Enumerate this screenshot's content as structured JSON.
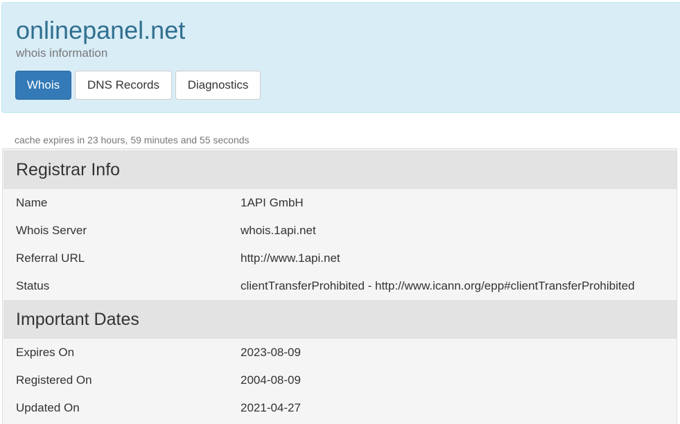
{
  "header": {
    "title": "onlinepanel.net",
    "subtitle": "whois information",
    "tabs": [
      {
        "label": "Whois",
        "active": true
      },
      {
        "label": "DNS Records",
        "active": false
      },
      {
        "label": "Diagnostics",
        "active": false
      }
    ]
  },
  "cache_note": "cache expires in 23 hours, 59 minutes and 55 seconds",
  "sections": [
    {
      "heading": "Registrar Info",
      "rows": [
        {
          "label": "Name",
          "value": "1API GmbH"
        },
        {
          "label": "Whois Server",
          "value": "whois.1api.net"
        },
        {
          "label": "Referral URL",
          "value": "http://www.1api.net"
        },
        {
          "label": "Status",
          "value": "clientTransferProhibited - http://www.icann.org/epp#clientTransferProhibited"
        }
      ]
    },
    {
      "heading": "Important Dates",
      "rows": [
        {
          "label": "Expires On",
          "value": "2023-08-09"
        },
        {
          "label": "Registered On",
          "value": "2004-08-09"
        },
        {
          "label": "Updated On",
          "value": "2021-04-27"
        }
      ]
    }
  ],
  "colors": {
    "header_bg": "#d9edf7",
    "title": "#31708f",
    "active_tab": "#337ab7",
    "section_bg": "#e3e3e3",
    "panel_bg": "#f5f5f5"
  }
}
